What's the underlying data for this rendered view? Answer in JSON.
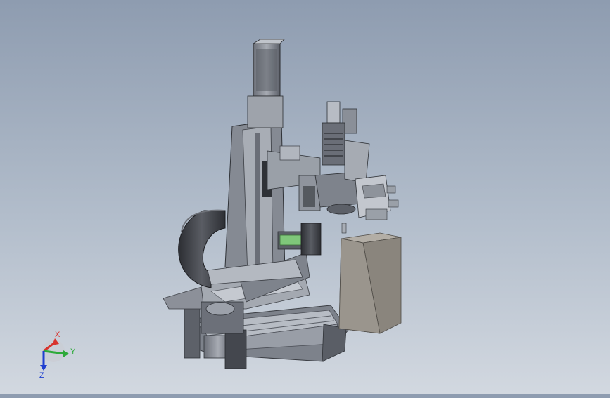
{
  "triad": {
    "x_label": "X",
    "y_label": "Y",
    "z_label": "Z",
    "x_color": "#d8322c",
    "y_color": "#2eaa3a",
    "z_color": "#1f3fd0"
  },
  "colors": {
    "metal_dark": "#4a4d55",
    "metal_mid": "#8a8f99",
    "metal_light": "#b9bec6",
    "accent_green": "#7fc77a",
    "block_gray": "#8f8a82"
  }
}
